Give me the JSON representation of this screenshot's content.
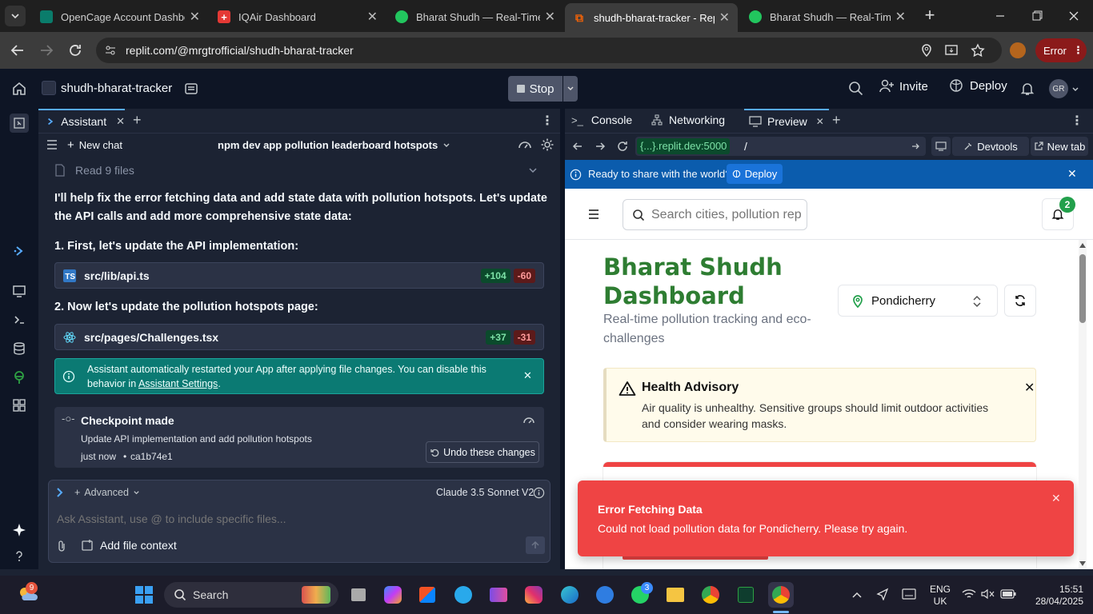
{
  "browser": {
    "tabs": [
      {
        "title": "OpenCage Account Dashboa",
        "favicon_color": "#0a7c6b"
      },
      {
        "title": "IQAir Dashboard",
        "favicon_color": "#e53935"
      },
      {
        "title": "Bharat Shudh — Real-Time P",
        "favicon_color": "#22c55e"
      },
      {
        "title": "shudh-bharat-tracker - Repli",
        "favicon_color": "#f26207"
      },
      {
        "title": "Bharat Shudh — Real-Time P",
        "favicon_color": "#22c55e"
      }
    ],
    "url": "replit.com/@mrgtrofficial/shudh-bharat-tracker",
    "profile_button": "Error"
  },
  "replit": {
    "project_name": "shudh-bharat-tracker",
    "stop_label": "Stop",
    "invite_label": "Invite",
    "deploy_label": "Deploy",
    "avatar_initials": "GR"
  },
  "assistant": {
    "tab_label": "Assistant",
    "new_chat": "New chat",
    "chat_title": "npm dev app pollution leaderboard hotspots",
    "read_files": "Read 9 files",
    "intro": "I'll help fix the error fetching data and add state data with pollution hotspots. Let's update the API calls and add more comprehensive state data:",
    "step1": "1. First, let's update the API implementation:",
    "file1": {
      "name": "src/lib/api.ts",
      "added": "+104",
      "removed": "-60"
    },
    "step2": "2. Now let's update the pollution hotspots page:",
    "file2": {
      "name": "src/pages/Challenges.tsx",
      "added": "+37",
      "removed": "-31"
    },
    "notice_text": "Assistant automatically restarted your App after applying file changes. You can disable this behavior in",
    "notice_link": "Assistant Settings",
    "checkpoint_title": "Checkpoint made",
    "checkpoint_desc": "Update API implementation and add pollution hotspots",
    "checkpoint_time": "just now",
    "checkpoint_hash": "ca1b74e1",
    "undo_label": "Undo these changes",
    "advanced_label": "Advanced",
    "model_label": "Claude 3.5 Sonnet V2",
    "input_placeholder": "Ask Assistant, use @ to include specific files...",
    "add_context": "Add file context"
  },
  "preview_panel": {
    "tabs": [
      "Console",
      "Networking",
      "Preview"
    ],
    "url_host": "{...}.replit.dev:5000",
    "url_path": "/",
    "devtools": "Devtools",
    "new_tab": "New tab",
    "banner_text": "Ready to share with the world?",
    "banner_deploy": "Deploy"
  },
  "app": {
    "search_placeholder": "Search cities, pollution rep",
    "notification_count": "2",
    "title_line1": "Bharat Shudh",
    "title_line2": "Dashboard",
    "subtitle": "Real-time pollution tracking and eco-challenges",
    "city": "Pondicherry",
    "advisory_title": "Health Advisory",
    "advisory_text": "Air quality is unhealthy. Sensitive groups should limit outdoor activities and consider wearing masks.",
    "toast_title": "Error Fetching Data",
    "toast_text": "Could not load pollution data for Pondicherry. Please try again."
  },
  "taskbar": {
    "weather_badge": "9",
    "search_label": "Search",
    "whatsapp_badge": "3",
    "lang_line1": "ENG",
    "lang_line2": "UK",
    "time": "15:51",
    "date": "28/04/2025"
  },
  "colors": {
    "app_green": "#2e7d32",
    "toast_red": "#ef4444",
    "deploy_blue": "#0b5cad",
    "notice_teal": "#0b7a73"
  }
}
